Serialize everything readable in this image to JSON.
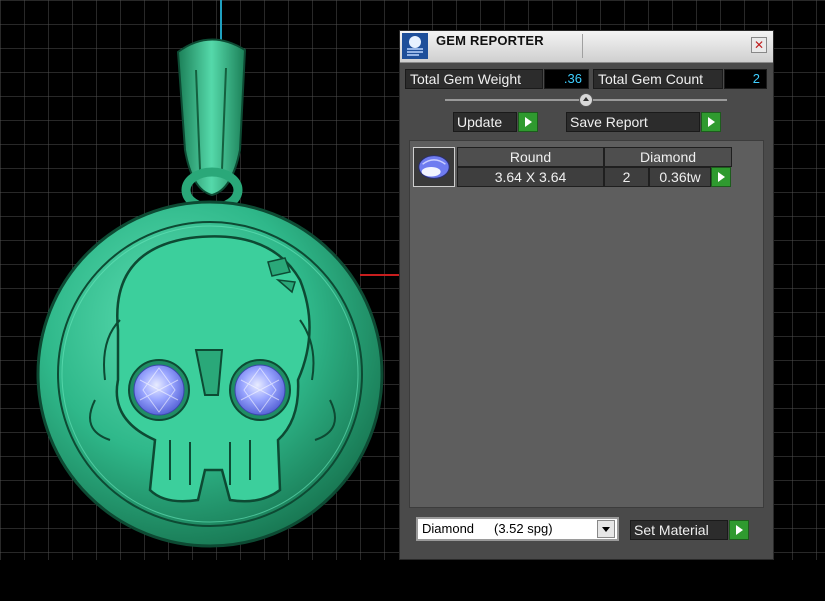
{
  "window": {
    "title": "GEM REPORTER",
    "close_glyph": "✕"
  },
  "stats": {
    "total_gem_weight_label": "Total Gem Weight",
    "total_gem_weight_value": ".36",
    "total_gem_count_label": "Total Gem Count",
    "total_gem_count_value": "2"
  },
  "toolbar": {
    "update_label": "Update",
    "save_report_label": "Save Report"
  },
  "gems": [
    {
      "shape": "Round",
      "material": "Diamond",
      "size": "3.64 X 3.64",
      "count": "2",
      "weight": "0.36tw"
    }
  ],
  "material_select": {
    "name": "Diamond",
    "spg": "(3.52 spg)"
  },
  "set_material_label": "Set Material",
  "colors": {
    "metal": "#2fb88a",
    "gem": "#7c8cff",
    "grid": "#5a5a5a",
    "accent_green": "#2f9a2f",
    "value_cyan": "#3ecfff"
  },
  "icons": [
    "gem-reporter-app-icon",
    "close-icon",
    "round-gem-icon",
    "play-arrow-icon",
    "chevron-down-icon",
    "slider-thumb-icon"
  ]
}
